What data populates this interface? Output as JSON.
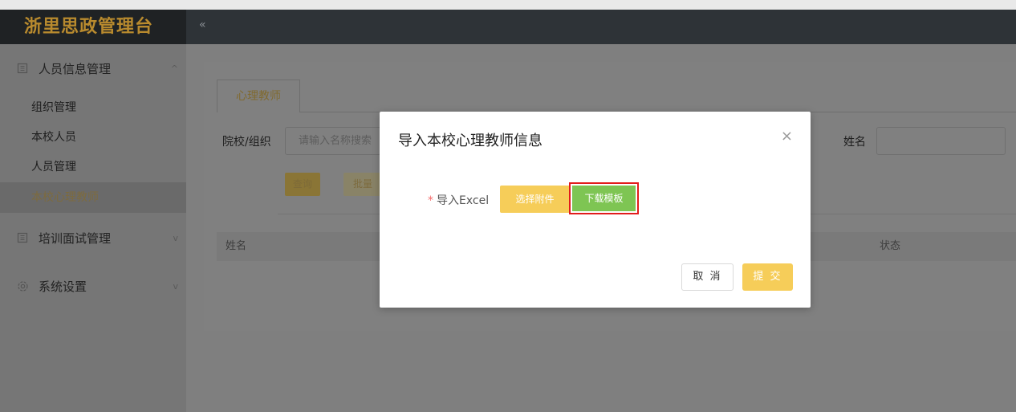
{
  "app": {
    "title": "浙里思政管理台"
  },
  "header": {
    "collapse_icon": "«"
  },
  "sidebar": {
    "groups": [
      {
        "label": "人员信息管理",
        "icon": "building-icon",
        "chevron": "^"
      },
      {
        "label": "培训面试管理",
        "icon": "building-icon",
        "chevron": "v"
      },
      {
        "label": "系统设置",
        "icon": "gear-icon",
        "chevron": "v"
      }
    ],
    "items": [
      {
        "label": "组织管理"
      },
      {
        "label": "本校人员"
      },
      {
        "label": "人员管理"
      },
      {
        "label": "本校心理教师"
      }
    ]
  },
  "main": {
    "tab_label": "心理教师",
    "filter": {
      "org_label": "院校/组织",
      "org_placeholder": "请输入名称搜索",
      "name_label": "姓名"
    },
    "buttons": {
      "query": "查询",
      "batch": "批量"
    },
    "table": {
      "columns": [
        "姓名",
        "状态"
      ]
    }
  },
  "modal": {
    "title": "导入本校心理教师信息",
    "close": "×",
    "field_label": "导入Excel",
    "required_mark": "*",
    "attach_button": "选择附件",
    "template_button": "下载模板",
    "cancel_button": "取 消",
    "submit_button": "提 交"
  },
  "colors": {
    "brand_gold": "#b88a2e",
    "primary_yellow": "#f6cd59",
    "success_green": "#7ec553",
    "highlight_red": "#e21c1c"
  }
}
